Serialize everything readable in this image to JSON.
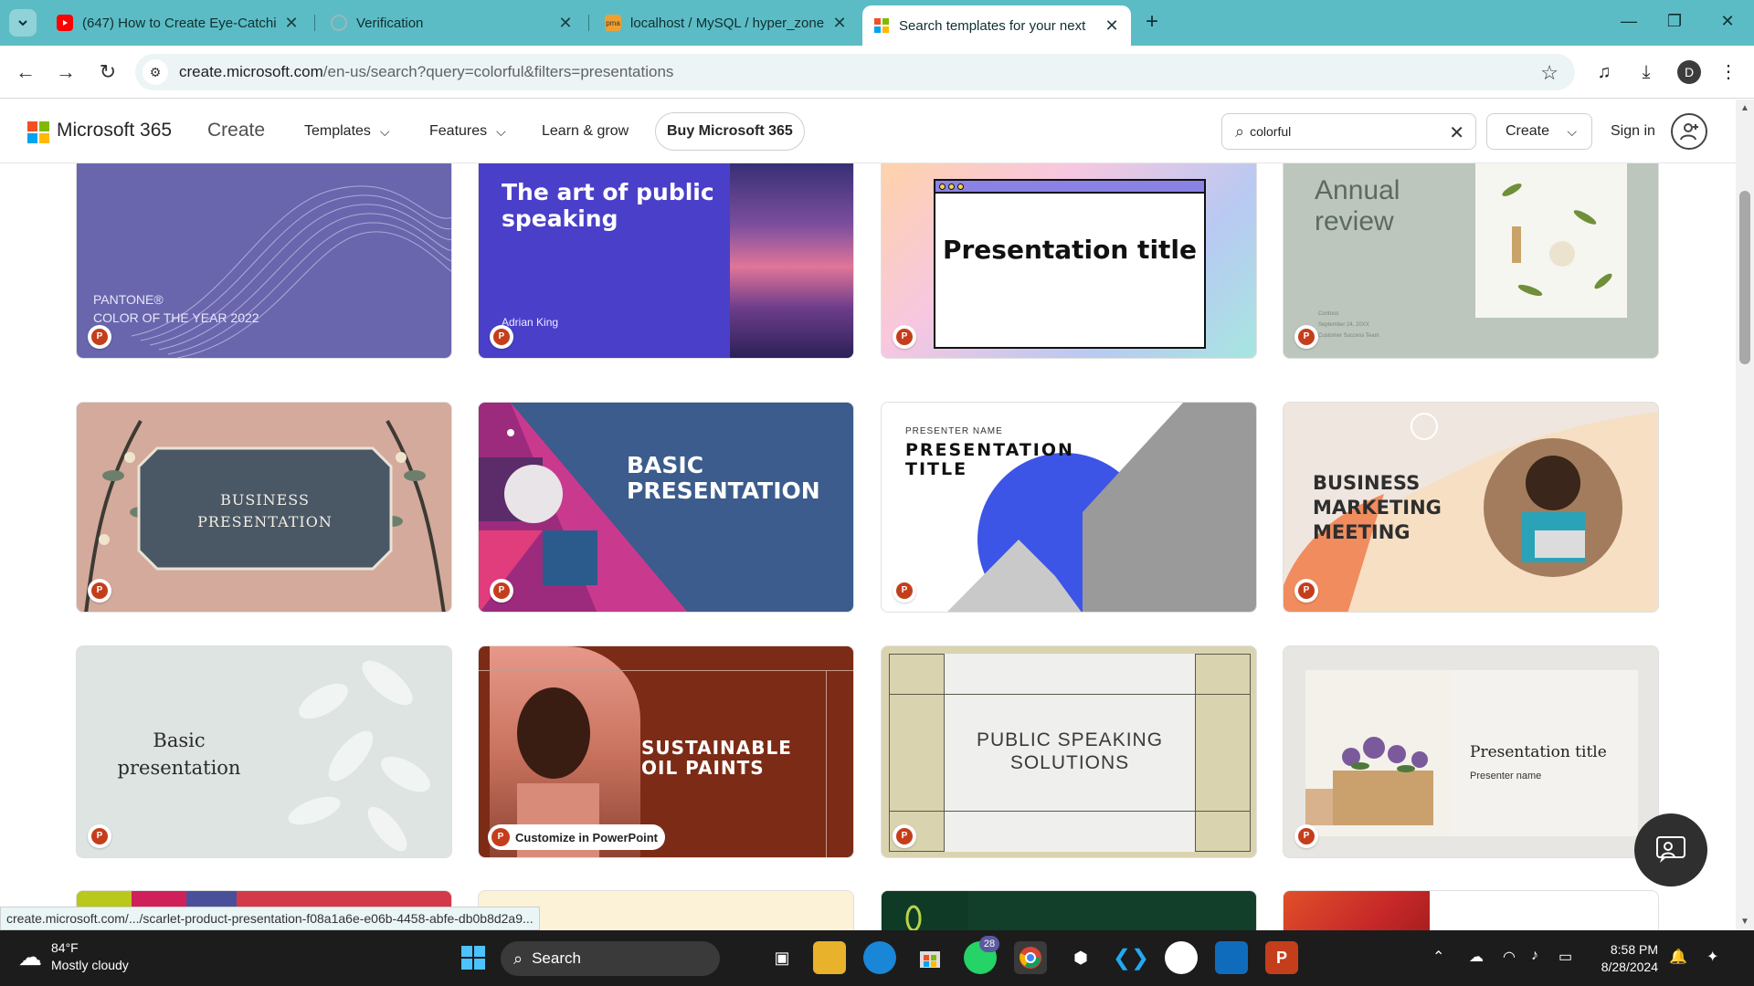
{
  "browser": {
    "tabs": [
      {
        "title": "(647) How to Create Eye-Catchi",
        "favicon": "youtube-icon"
      },
      {
        "title": "Verification",
        "favicon": "globe-icon"
      },
      {
        "title": "localhost / MySQL / hyper_zone",
        "favicon": "phpmyadmin-icon"
      },
      {
        "title": "Search templates for your next",
        "favicon": "microsoft-icon",
        "active": true
      }
    ],
    "url_host": "create.microsoft.com",
    "url_path": "/en-us/search?query=colorful&filters=presentations",
    "profile_initial": "D",
    "status_url": "create.microsoft.com/.../scarlet-product-presentation-f08a1a6e-e06b-4458-abfe-db0b8d2a9..."
  },
  "header": {
    "brand": "Microsoft 365",
    "create": "Create",
    "nav": [
      "Templates",
      "Features",
      "Learn & grow"
    ],
    "buy": "Buy Microsoft 365",
    "search_value": "colorful",
    "create_button": "Create",
    "sign_in": "Sign in"
  },
  "cards": [
    {
      "lines": [
        "PANTONE®",
        "COLOR OF THE YEAR 2022"
      ]
    },
    {
      "title": "The art of public speaking",
      "author": "Adrian King"
    },
    {
      "title": "Presentation title"
    },
    {
      "title": "Annual review",
      "small": [
        "Contoso",
        "September 24, 20XX",
        "Customer Success Team"
      ]
    },
    {
      "lines": [
        "BUSINESS",
        "PRESENTATION"
      ]
    },
    {
      "lines": [
        "BASIC",
        "PRESENTATION"
      ]
    },
    {
      "kicker": "PRESENTER NAME",
      "lines": [
        "PRESENTATION",
        "TITLE"
      ]
    },
    {
      "lines": [
        "BUSINESS",
        "MARKETING",
        "MEETING"
      ]
    },
    {
      "lines": [
        "Basic",
        "presentation"
      ]
    },
    {
      "lines": [
        "SUSTAINABLE",
        "OIL PAINTS"
      ],
      "customize": "Customize in PowerPoint"
    },
    {
      "lines": [
        "PUBLIC SPEAKING",
        "SOLUTIONS"
      ]
    },
    {
      "title": "Presentation title",
      "subtitle": "Presenter name"
    }
  ],
  "taskbar": {
    "weather_temp": "84°F",
    "weather_desc": "Mostly cloudy",
    "search": "Search",
    "whatsapp_badge": "28",
    "time": "8:58 PM",
    "date": "8/28/2024"
  },
  "colors": {
    "tabbar": "#5cbcc5",
    "ppt_red": "#c43e1c",
    "taskbar": "#1c1c1c"
  }
}
